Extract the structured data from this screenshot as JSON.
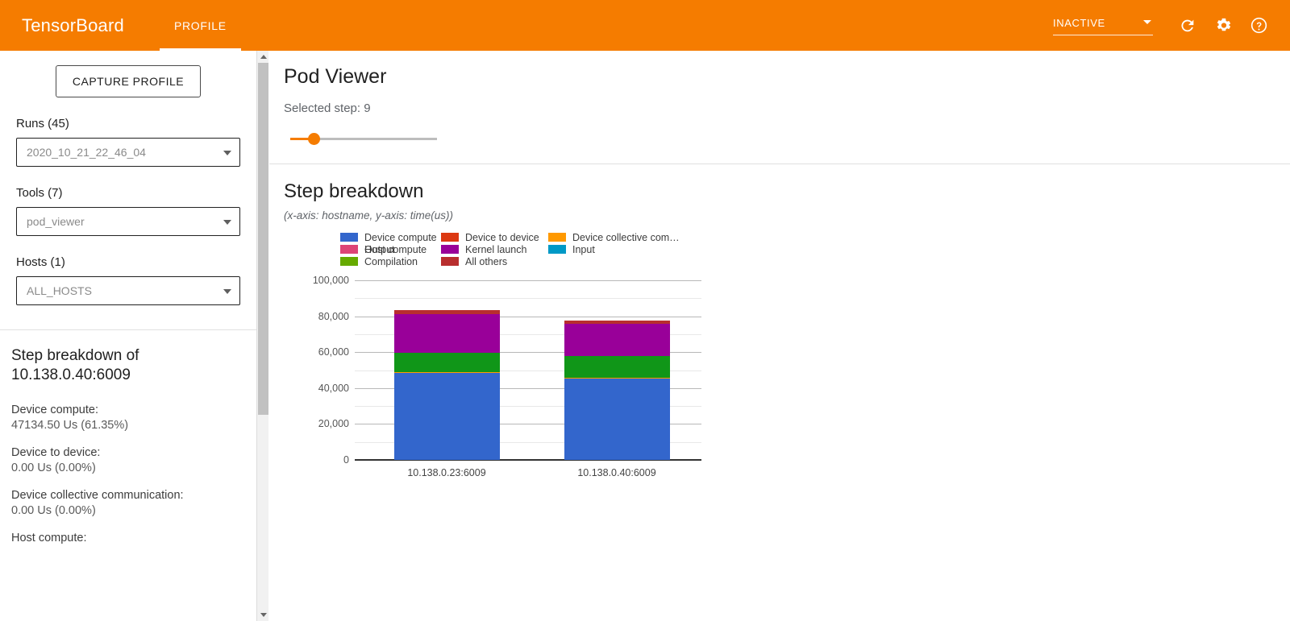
{
  "topbar": {
    "brand": "TensorBoard",
    "tabs": [
      {
        "label": "PROFILE",
        "active": true
      }
    ],
    "status": "INACTIVE",
    "icons": [
      "refresh-icon",
      "settings-gear-icon",
      "help-circle-icon"
    ]
  },
  "sidebar": {
    "capture_button": "CAPTURE PROFILE",
    "fields": [
      {
        "label": "Runs (45)",
        "value": "2020_10_21_22_46_04",
        "name": "runs"
      },
      {
        "label": "Tools (7)",
        "value": "pod_viewer",
        "name": "tools"
      },
      {
        "label": "Hosts (1)",
        "value": "ALL_HOSTS",
        "name": "hosts"
      }
    ],
    "detail": {
      "title": "Step breakdown of 10.138.0.40:6009",
      "items": [
        {
          "key": "Device compute:",
          "value": "47134.50 Us (61.35%)"
        },
        {
          "key": "Device to device:",
          "value": "0.00 Us (0.00%)"
        },
        {
          "key": "Device collective communication:",
          "value": "0.00 Us (0.00%)"
        },
        {
          "key": "Host compute:",
          "value": ""
        }
      ]
    }
  },
  "main": {
    "page_title": "Pod Viewer",
    "selected_step_label": "Selected step: 9",
    "selected_step": 9,
    "slider_percent": 15
  },
  "chart_data": {
    "type": "bar",
    "stacked": true,
    "title": "Step breakdown",
    "subtitle": "(x-axis: hostname, y-axis: time(us))",
    "xlabel": "hostname",
    "ylabel": "time(us)",
    "ylim": [
      0,
      100000
    ],
    "yticks": [
      0,
      20000,
      40000,
      60000,
      80000,
      100000
    ],
    "ytick_labels": [
      "0",
      "20,000",
      "40,000",
      "60,000",
      "80,000",
      "100,000"
    ],
    "minor_gridlines": [
      10000,
      30000,
      50000,
      70000,
      90000
    ],
    "grid": true,
    "legend_position": "top",
    "categories": [
      "10.138.0.23:6009",
      "10.138.0.40:6009"
    ],
    "series": [
      {
        "name": "Device compute",
        "color": "#3366cc",
        "values": [
          48300,
          45200
        ]
      },
      {
        "name": "Device to device",
        "color": "#dc3912",
        "values": [
          0,
          0
        ]
      },
      {
        "name": "Device collective com…",
        "color": "#ff9900",
        "values": [
          600,
          700
        ]
      },
      {
        "name": "Host compute",
        "color": "#109618",
        "values": [
          10900,
          11900
        ]
      },
      {
        "name": "Kernel launch",
        "color": "#990099",
        "values": [
          21500,
          18000
        ]
      },
      {
        "name": "Input",
        "color": "#0099c6",
        "values": [
          0,
          0
        ]
      },
      {
        "name": "Output",
        "color": "#dd4477",
        "values": [
          0,
          0
        ]
      },
      {
        "name": "Compilation",
        "color": "#66aa00",
        "values": [
          0,
          0
        ]
      },
      {
        "name": "All others",
        "color": "#b82e2e",
        "values": [
          1900,
          1700
        ]
      }
    ]
  }
}
